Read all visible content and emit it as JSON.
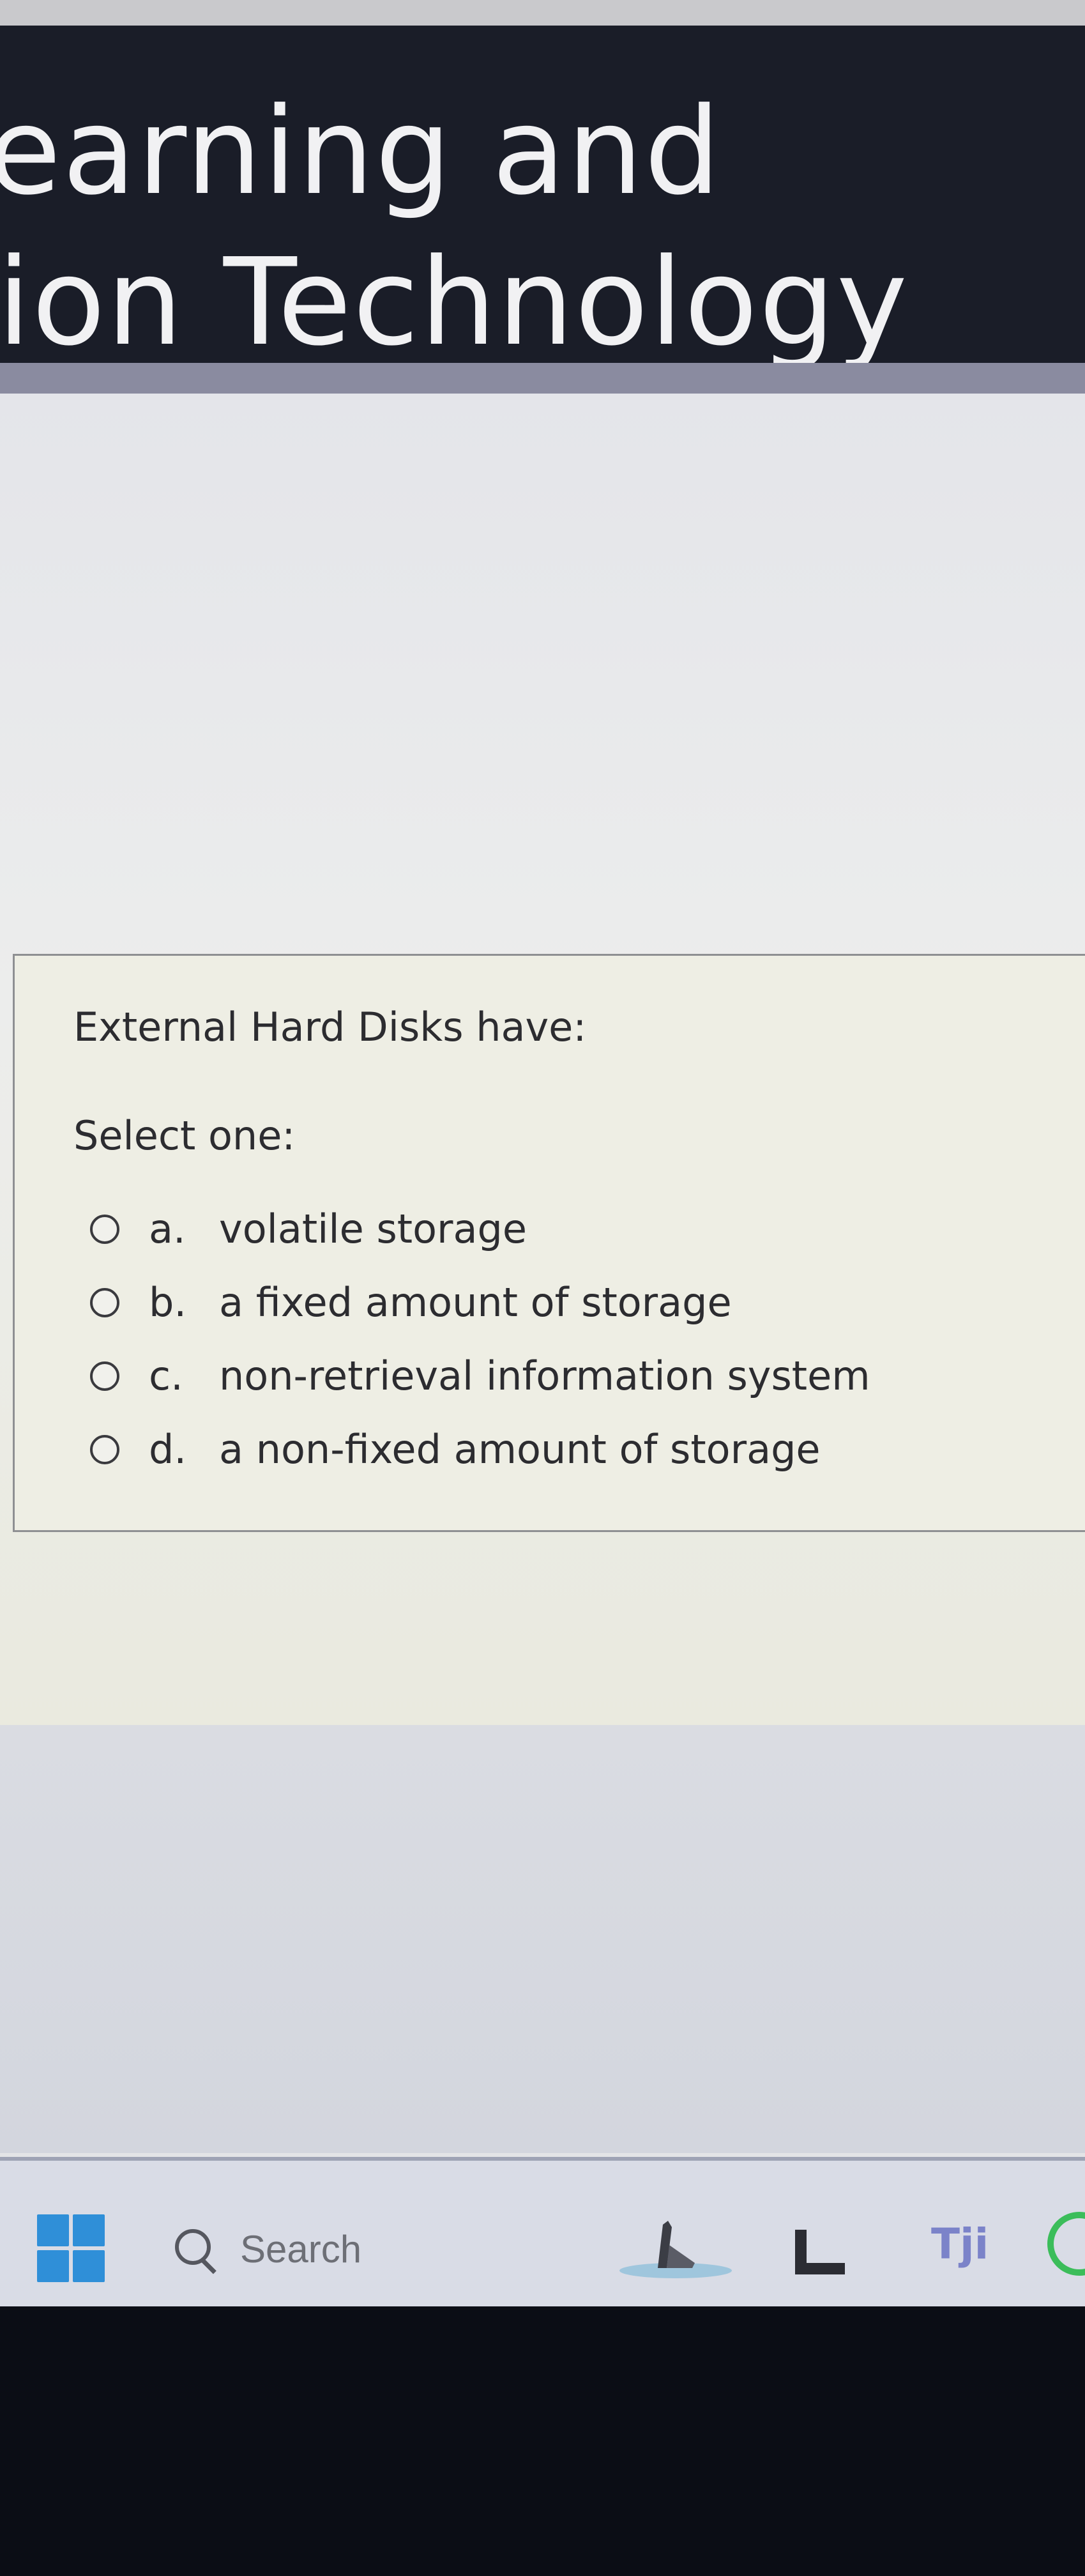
{
  "header": {
    "title_line1": "earning and",
    "title_line2": "tion Technology"
  },
  "question": {
    "text": "External Hard Disks have:",
    "instruction": "Select one:",
    "options": [
      {
        "letter": "a.",
        "text": "volatile storage"
      },
      {
        "letter": "b.",
        "text": "a fixed amount of storage"
      },
      {
        "letter": "c.",
        "text": "non-retrieval information system"
      },
      {
        "letter": "d.",
        "text": "a non-fixed amount of storage"
      }
    ]
  },
  "taskbar": {
    "search_label": "Search",
    "icons": [
      "windows-start-icon",
      "search-icon",
      "widgets-icon",
      "task-view-icon",
      "teams-icon",
      "whatsapp-icon"
    ],
    "teams_glyph": "Tji"
  },
  "colors": {
    "header_bg": "#1a1d28",
    "start_blue": "#2f8fd8",
    "whatsapp_green": "#3bbd5a",
    "teams_purple": "#7b83c9"
  }
}
